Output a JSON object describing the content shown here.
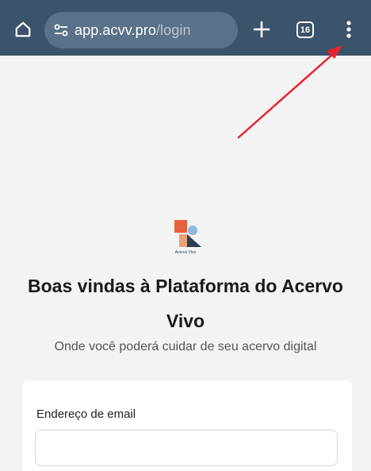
{
  "browser": {
    "url_host": "app.acvv.pro",
    "url_path": "/login",
    "tab_count": "16",
    "toolbar_color": "#3b536b"
  },
  "icons": {
    "home": "home-icon",
    "site_info": "tune-icon",
    "new_tab": "plus-icon",
    "menu": "more-vert-icon"
  },
  "page": {
    "logo_caption": "Acervo Vivo",
    "heading": "Boas vindas à Plataforma do Acervo Vivo",
    "subtitle": "Onde você poderá cuidar de seu acervo digital",
    "email_label": "Endereço de email",
    "email_value": ""
  },
  "colors": {
    "logo_orange": "#e8603c",
    "logo_blue": "#8fb8d8",
    "logo_navy": "#2d3e50",
    "logo_peach": "#e9a07a",
    "annotation_red": "#e8232a"
  }
}
